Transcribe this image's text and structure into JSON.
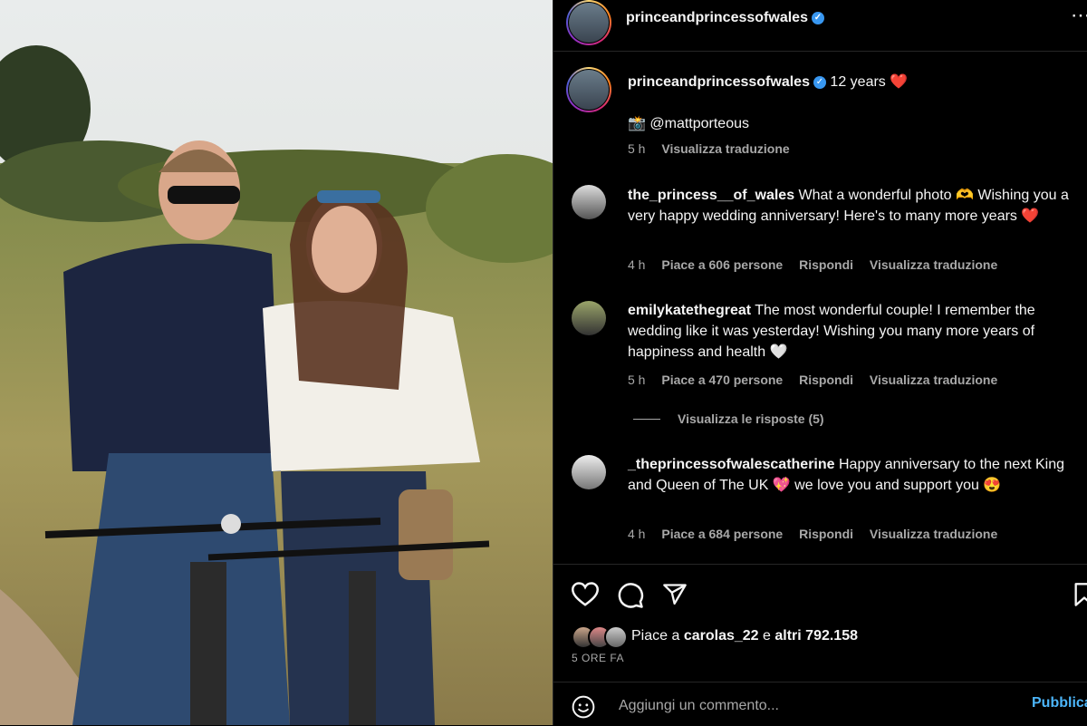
{
  "post": {
    "author": "princeandprincessofwales",
    "more_icon": "more-dots-icon"
  },
  "caption": {
    "author": "princeandprincessofwales",
    "text": "12 years ❤️",
    "credit": "📸 @mattporteous",
    "time": "5 h",
    "translate": "Visualizza traduzione"
  },
  "comments": [
    {
      "user": "the_princess__of_wales",
      "text": "What a wonderful photo 🫶 Wishing you a very happy wedding anniversary! Here's to many more years ❤️",
      "time": "4 h",
      "likes": "Piace a 606 persone",
      "reply": "Rispondi",
      "translate": "Visualizza traduzione"
    },
    {
      "user": "emilykatethegreat",
      "text": "The most wonderful couple! I remember the wedding like it was yesterday! Wishing you many more years of happiness and health 🤍",
      "time": "5 h",
      "likes": "Piace a 470 persone",
      "reply": "Rispondi",
      "translate": "Visualizza traduzione",
      "view_replies": "Visualizza le risposte (5)"
    },
    {
      "user": "_theprincessofwalescatherine",
      "text": "Happy anniversary to the next King and Queen of The UK 💖 we love you and support you 😍",
      "time": "4 h",
      "likes": "Piace a 684 persone",
      "reply": "Rispondi",
      "translate": "Visualizza traduzione"
    }
  ],
  "actions": {
    "icons": [
      "heart-icon",
      "comment-icon",
      "share-icon",
      "bookmark-icon"
    ]
  },
  "likes": {
    "prefix": "Piace a",
    "user": "carolas_22",
    "middle": "e",
    "others": "altri 792.158"
  },
  "time_ago": "5 ORE FA",
  "comment_box": {
    "placeholder": "Aggiungi un commento...",
    "publish": "Pubblica",
    "emoji_icon": "emoji-icon"
  },
  "colors": {
    "background": "#000000",
    "link": "#4cb5f9",
    "verified": "#3897f0",
    "secondary_text": "#a8a8a8"
  }
}
